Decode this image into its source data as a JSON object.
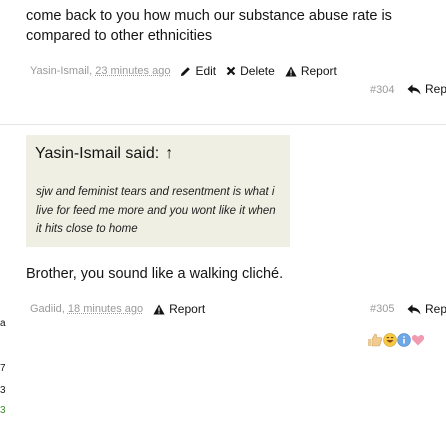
{
  "post_304": {
    "body": "come back to you how much our substance abuse rate is compared to other ethnicities",
    "author": "Yasin-Ismail",
    "time": "23 minutes ago",
    "edit_label": "Edit",
    "delete_label": "Delete",
    "report_label": "Report",
    "number": "#304",
    "reply_label": "Rep"
  },
  "post_305": {
    "quote": {
      "header": "Yasin-Ismail said:",
      "arrow": "↑",
      "text": "sjw and feminist tears and resentment is what i live for feed me more and you wont like it when it hits close to home"
    },
    "body": "Brother, you sound like a walking cliché.",
    "author": "Gadiid",
    "time": "18 minutes ago",
    "report_label": "Report",
    "number": "#305",
    "reply_label": "Rep",
    "reactions": [
      "like-icon",
      "laugh-icon",
      "info-icon",
      "heart-icon"
    ]
  },
  "side_marks": [
    "a",
    "7",
    "3",
    "3"
  ],
  "colors": {
    "quote_bg": "#f0efe3",
    "meta": "#9a9a9a",
    "side_green": "#3b8a2e"
  }
}
